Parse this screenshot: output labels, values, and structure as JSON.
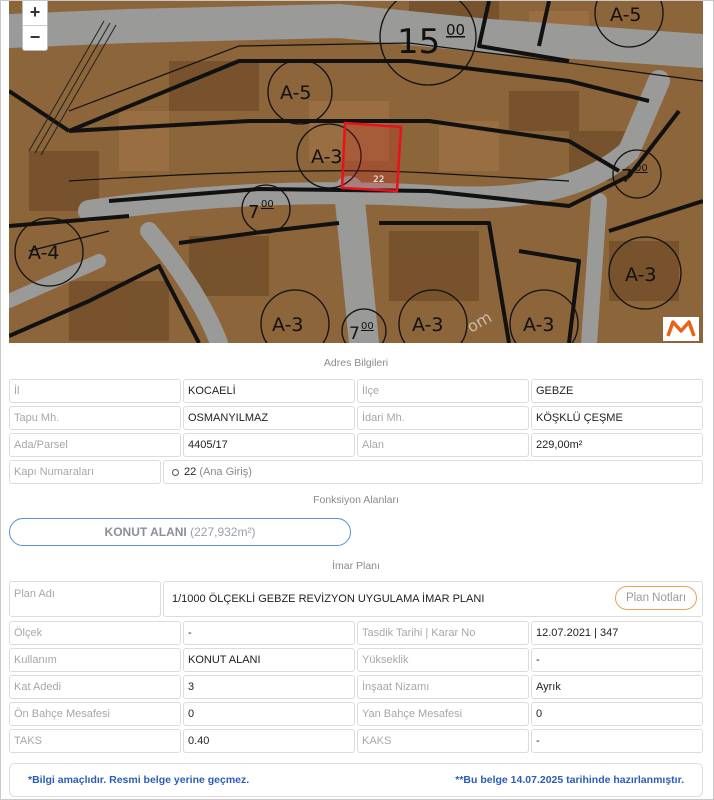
{
  "map": {
    "zoom_in": "+",
    "zoom_out": "−",
    "labels": {
      "big_height": "15",
      "big_height_sup": "00",
      "a5_top_right": "A-5",
      "a5_mid": "A-5",
      "a3_parcel": "A-3",
      "parcel_no": "22",
      "a4_left": "A-4",
      "a3_right": "A-3",
      "a3_bottom1": "A-3",
      "a3_bottom2": "A-3",
      "a3_bottom3": "A-3",
      "h7_left": "7",
      "h7_left_sup": "00",
      "h7_right": "7",
      "h7_right_sup": "00",
      "h7_bottom": "7",
      "h7_bottom_sup": "00",
      "watermark": "om"
    },
    "parcel_outline_color": "#e8121b"
  },
  "address": {
    "title": "Adres Bilgileri",
    "il_label": "İl",
    "il_value": "KOCAELİ",
    "ilce_label": "İlçe",
    "ilce_value": "GEBZE",
    "tapu_label": "Tapu Mh.",
    "tapu_value": "OSMANYILMAZ",
    "idari_label": "İdari Mh.",
    "idari_value": "KÖŞKLÜ ÇEŞME",
    "ada_label": "Ada/Parsel",
    "ada_value": "4405/17",
    "alan_label": "Alan",
    "alan_value": "229,00m²",
    "kapi_label": "Kapı Numaraları",
    "kapi_no": "22",
    "kapi_note": "(Ana Giriş)"
  },
  "functions": {
    "title": "Fonksiyon Alanları",
    "zone_name": "KONUT ALANI",
    "zone_area": "(227,932m²)",
    "accent": "#5b8fd6"
  },
  "plan": {
    "title": "İmar Planı",
    "plan_adi_label": "Plan Adı",
    "plan_adi_value": "1/1000 ÖLÇEKLİ GEBZE REVİZYON UYGULAMA İMAR PLANI",
    "notes_button": "Plan Notları",
    "olcek_label": "Ölçek",
    "olcek_value": "-",
    "tasdik_label": "Tasdik Tarihi | Karar No",
    "tasdik_value": "12.07.2021 | 347",
    "kullanim_label": "Kullanım",
    "kullanim_value": "KONUT ALANI",
    "yukseklik_label": "Yükseklik",
    "yukseklik_value": "-",
    "kat_label": "Kat Adedi",
    "kat_value": "3",
    "insaat_label": "İnşaat Nizamı",
    "insaat_value": "Ayrık",
    "on_bahce_label": "Ön Bahçe Mesafesi",
    "on_bahce_value": "0",
    "yan_bahce_label": "Yan Bahçe Mesafesi",
    "yan_bahce_value": "0",
    "taks_label": "TAKS",
    "taks_value": "0.40",
    "kaks_label": "KAKS",
    "kaks_value": "-"
  },
  "footer": {
    "left_note": "*Bilgi amaçlıdır. Resmi belge yerine geçmez.",
    "right_note": "**Bu belge 14.07.2025 tarihinde hazırlanmıştır.",
    "color": "#2b5cb8"
  }
}
